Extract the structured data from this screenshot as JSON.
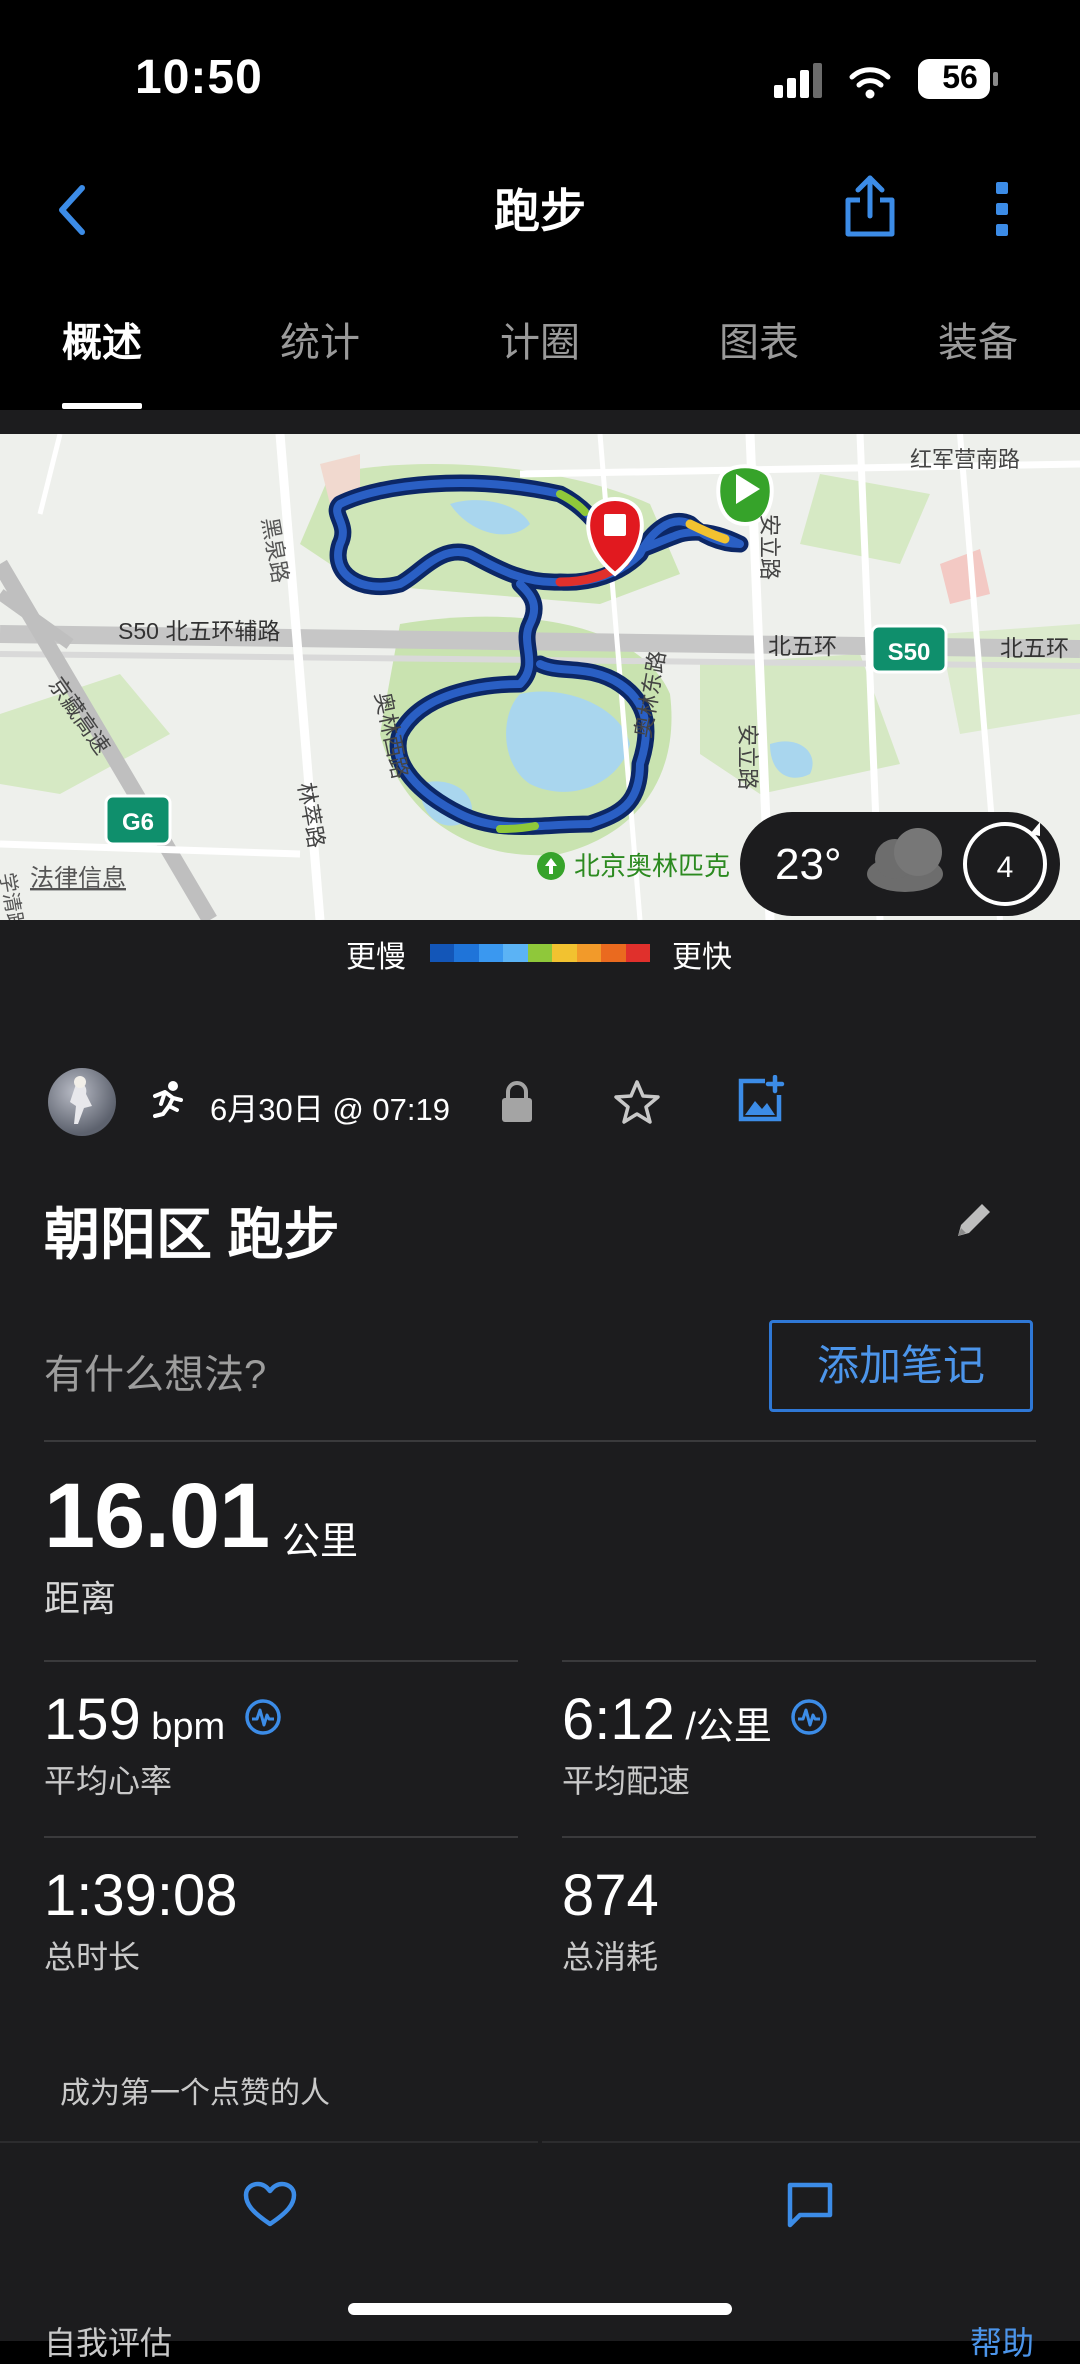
{
  "status_bar": {
    "time": "10:50",
    "battery": "56"
  },
  "header": {
    "title": "跑步"
  },
  "tabs": [
    {
      "label": "概述",
      "active": true
    },
    {
      "label": "统计",
      "active": false
    },
    {
      "label": "计圈",
      "active": false
    },
    {
      "label": "图表",
      "active": false
    },
    {
      "label": "装备",
      "active": false
    }
  ],
  "map": {
    "labels": {
      "heiquan": "黑泉路",
      "hongjun": "红军营南路",
      "s50_aux": "S50 北五环辅路",
      "north5_mid": "北五环",
      "s50_badge": "S50",
      "north5_right": "北五环",
      "jingzang": "京藏高速",
      "olympic_west": "奥林西路",
      "olympic_east": "奥林东路",
      "anli_top": "安立路",
      "anli_mid": "安立路",
      "lincui": "林萃路",
      "g6_badge": "G6",
      "park": "北京奥林匹克",
      "legal": "法律信息",
      "left_edge_road": "学清路"
    },
    "weather": {
      "temp": "23°",
      "wind": "4"
    }
  },
  "pace_legend": {
    "slow_label": "更慢",
    "fast_label": "更快",
    "colors": [
      "#1356b8",
      "#1f74d9",
      "#3a98f0",
      "#5bb3f5",
      "#8fc83a",
      "#f2c230",
      "#f29a2a",
      "#ea6a1f",
      "#e0302c"
    ]
  },
  "activity": {
    "date": "6月30日 @ 07:19",
    "title": "朝阳区 跑步",
    "notes_prompt": "有什么想法?",
    "add_note": "添加笔记"
  },
  "stats": {
    "distance": {
      "value": "16.01",
      "unit": "公里",
      "label": "距离"
    },
    "avg_hr": {
      "value": "159",
      "unit": "bpm",
      "label": "平均心率"
    },
    "avg_pace": {
      "value": "6:12",
      "unit": "/公里",
      "label": "平均配速"
    },
    "duration": {
      "value": "1:39:08",
      "label": "总时长"
    },
    "calories": {
      "value": "874",
      "label": "总消耗"
    }
  },
  "social": {
    "likes_text": "成为第一个点赞的人"
  },
  "bottom_peek": {
    "self_eval": "自我评估",
    "help": "帮助"
  },
  "colors": {
    "accent": "#3c8ce7",
    "background": "#1c1c1e",
    "route": "#1a3f8f"
  }
}
